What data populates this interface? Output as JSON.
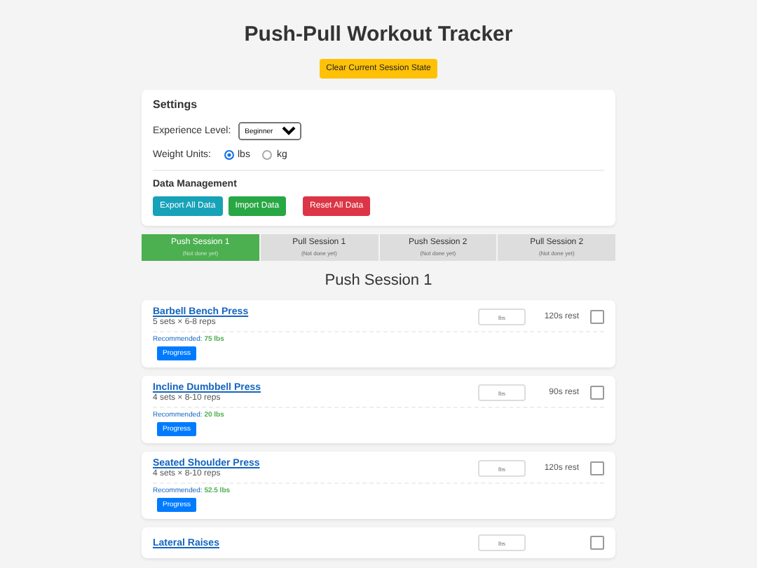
{
  "title": "Push-Pull Workout Tracker",
  "clear_button": "Clear Current Session State",
  "settings": {
    "heading": "Settings",
    "experience_label": "Experience Level:",
    "experience_value": "Beginner",
    "units_label": "Weight Units:",
    "units": [
      {
        "label": "lbs",
        "selected": true
      },
      {
        "label": "kg",
        "selected": false
      }
    ],
    "data_heading": "Data Management",
    "buttons": [
      {
        "label": "Export All Data",
        "kind": "info"
      },
      {
        "label": "Import Data",
        "kind": "success"
      },
      {
        "label": "Reset All Data",
        "kind": "danger"
      }
    ]
  },
  "tabs": [
    {
      "label": "Push Session 1",
      "status": "(Not done yet)",
      "selected": true
    },
    {
      "label": "Pull Session 1",
      "status": "(Not done yet)",
      "selected": false
    },
    {
      "label": "Push Session 2",
      "status": "(Not done yet)",
      "selected": false
    },
    {
      "label": "Pull Session 2",
      "status": "(Not done yet)",
      "selected": false
    }
  ],
  "session_heading": "Push Session 1",
  "exercises": [
    {
      "name": "Barbell Bench Press",
      "scheme": "5 sets × 6-8 reps",
      "placeholder": "lbs",
      "rest": "120s rest",
      "checked": false,
      "recommended_label": "Recommended:",
      "recommended_value": "75 lbs",
      "progress": "Progress"
    },
    {
      "name": "Incline Dumbbell Press",
      "scheme": "4 sets × 8-10 reps",
      "placeholder": "lbs",
      "rest": "90s rest",
      "checked": false,
      "recommended_label": "Recommended:",
      "recommended_value": "20 lbs",
      "progress": "Progress"
    },
    {
      "name": "Seated Shoulder Press",
      "scheme": "4 sets × 8-10 reps",
      "placeholder": "lbs",
      "rest": "120s rest",
      "checked": false,
      "recommended_label": "Recommended:",
      "recommended_value": "52.5 lbs",
      "progress": "Progress"
    },
    {
      "name": "Lateral Raises",
      "placeholder": "lbs",
      "checked": false
    }
  ]
}
